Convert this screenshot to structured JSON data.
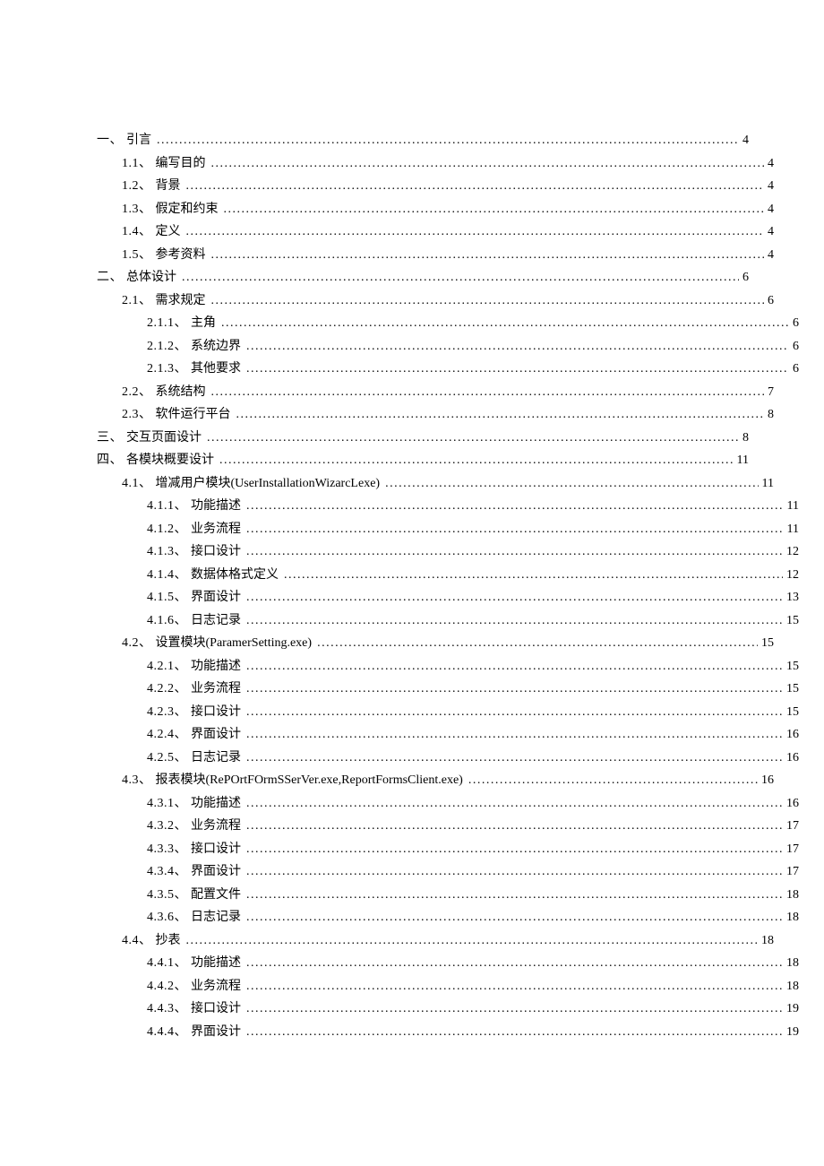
{
  "toc": [
    {
      "level": 1,
      "num": "一、",
      "title": "引言",
      "page": "4"
    },
    {
      "level": 2,
      "num": "1.1、",
      "title": "编写目的",
      "page": "4"
    },
    {
      "level": 2,
      "num": "1.2、",
      "title": "背景",
      "page": "4"
    },
    {
      "level": 2,
      "num": "1.3、",
      "title": "假定和约束",
      "page": "4"
    },
    {
      "level": 2,
      "num": "1.4、",
      "title": "定义",
      "page": "4"
    },
    {
      "level": 2,
      "num": "1.5、",
      "title": "参考资料",
      "page": "4"
    },
    {
      "level": 1,
      "num": "二、",
      "title": "总体设计",
      "page": "6"
    },
    {
      "level": 2,
      "num": "2.1、",
      "title": "需求规定",
      "page": "6"
    },
    {
      "level": 3,
      "num": "2.1.1、",
      "title": "主角",
      "page": "6"
    },
    {
      "level": 3,
      "num": "2.1.2、",
      "title": "系统边界",
      "page": "6"
    },
    {
      "level": 3,
      "num": "2.1.3、",
      "title": "其他要求",
      "page": "6"
    },
    {
      "level": 2,
      "num": "2.2、",
      "title": "系统结构",
      "page": "7"
    },
    {
      "level": 2,
      "num": "2.3、",
      "title": "软件运行平台",
      "page": "8"
    },
    {
      "level": 1,
      "num": "三、",
      "title": "交互页面设计",
      "page": "8"
    },
    {
      "level": 1,
      "num": "四、",
      "title": "各模块概要设计",
      "page": "11"
    },
    {
      "level": 2,
      "num": "4.1、",
      "title": "增减用户模块(UserInstallationWizarcLexe)",
      "page": "11"
    },
    {
      "level": 3,
      "num": "4.1.1、",
      "title": "功能描述",
      "page": "11"
    },
    {
      "level": 3,
      "num": "4.1.2、",
      "title": "业务流程",
      "page": "11"
    },
    {
      "level": 3,
      "num": "4.1.3、",
      "title": "接口设计",
      "page": "12"
    },
    {
      "level": 3,
      "num": "4.1.4、",
      "title": "数据体格式定义",
      "page": "12"
    },
    {
      "level": 3,
      "num": "4.1.5、",
      "title": "界面设计",
      "page": "13"
    },
    {
      "level": 3,
      "num": "4.1.6、",
      "title": "日志记录",
      "page": "15"
    },
    {
      "level": 2,
      "num": "4.2、",
      "title": "设置模块(ParamerSetting.exe)",
      "page": "15"
    },
    {
      "level": 3,
      "num": "4.2.1、",
      "title": "功能描述",
      "page": "15"
    },
    {
      "level": 3,
      "num": "4.2.2、",
      "title": "业务流程",
      "page": "15"
    },
    {
      "level": 3,
      "num": "4.2.3、",
      "title": "接口设计",
      "page": "15"
    },
    {
      "level": 3,
      "num": "4.2.4、",
      "title": "界面设计",
      "page": "16"
    },
    {
      "level": 3,
      "num": "4.2.5、",
      "title": "日志记录",
      "page": "16"
    },
    {
      "level": 2,
      "num": "4.3、",
      "title": "报表模块(RePOrtFOrmSSerVer.exe,ReportFormsClient.exe)",
      "page": "16"
    },
    {
      "level": 3,
      "num": "4.3.1、",
      "title": "功能描述",
      "page": "16"
    },
    {
      "level": 3,
      "num": "4.3.2、",
      "title": "业务流程",
      "page": "17"
    },
    {
      "level": 3,
      "num": "4.3.3、",
      "title": "接口设计",
      "page": "17"
    },
    {
      "level": 3,
      "num": "4.3.4、",
      "title": "界面设计",
      "page": "17"
    },
    {
      "level": 3,
      "num": "4.3.5、",
      "title": "配置文件",
      "page": "18"
    },
    {
      "level": 3,
      "num": "4.3.6、",
      "title": "日志记录",
      "page": "18"
    },
    {
      "level": 2,
      "num": "4.4、",
      "title": "抄表",
      "page": "18"
    },
    {
      "level": 3,
      "num": "4.4.1、",
      "title": "功能描述",
      "page": "18"
    },
    {
      "level": 3,
      "num": "4.4.2、",
      "title": "业务流程",
      "page": "18"
    },
    {
      "level": 3,
      "num": "4.4.3、",
      "title": "接口设计",
      "page": "19"
    },
    {
      "level": 3,
      "num": "4.4.4、",
      "title": "界面设计",
      "page": "19"
    }
  ]
}
